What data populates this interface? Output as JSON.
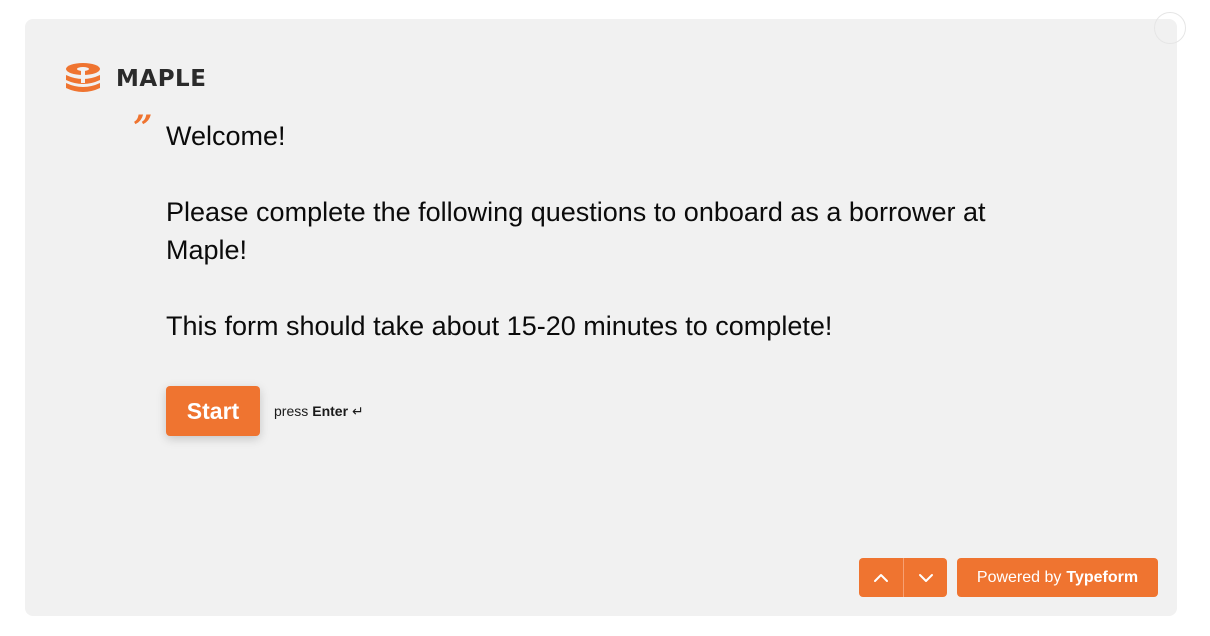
{
  "brand": {
    "name": "MAPLE",
    "accent_color": "#ef7430",
    "logo_icon": "maple-stack-icon"
  },
  "welcome": {
    "quote_glyph": "”",
    "paragraphs": [
      "Welcome!",
      "Please complete the following questions to onboard as a borrower at Maple!",
      "This form should take about 15-20 minutes to complete!"
    ]
  },
  "start": {
    "label": "Start",
    "hint_prefix": "press",
    "hint_key": "Enter",
    "hint_icon": "↵"
  },
  "footer": {
    "up_icon": "chevron-up-icon",
    "down_icon": "chevron-down-icon",
    "powered_prefix": "Powered by",
    "powered_brand": "Typeform"
  },
  "colors": {
    "panel_background": "#f1f1f1",
    "text": "#0b0b0b"
  }
}
